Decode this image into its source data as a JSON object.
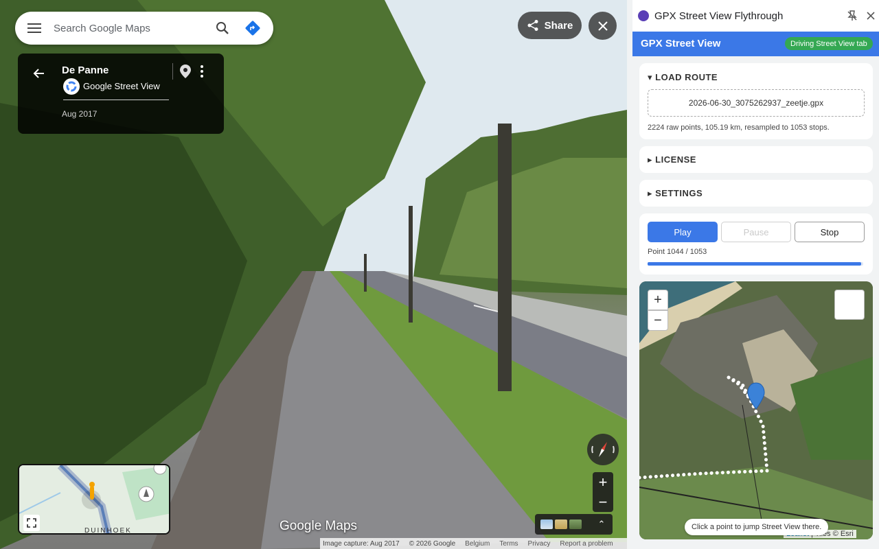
{
  "maps": {
    "search_placeholder": "Search Google Maps",
    "place": {
      "title": "De Panne",
      "provider": "Google Street View",
      "date": "Aug 2017"
    },
    "share_label": "Share",
    "logo_text": "Google Maps",
    "minimap_label": "DUINHOEK",
    "footer": {
      "capture": "Image capture: Aug 2017",
      "copyright": "© 2026 Google",
      "country": "Belgium",
      "terms": "Terms",
      "privacy": "Privacy",
      "report": "Report a problem"
    },
    "zoom_in": "+",
    "zoom_out": "−",
    "expand_glyph": "⌃"
  },
  "extension": {
    "window_title": "GPX Street View Flythrough",
    "app_title": "GPX Street View",
    "badge": "Driving Street View tab",
    "sections": {
      "load_route": "LOAD ROUTE",
      "license": "LICENSE",
      "settings": "SETTINGS"
    },
    "file_name": "2026-06-30_3075262937_zeetje.gpx",
    "route_stats": "2224 raw points, 105.19 km, resampled to 1053 stops.",
    "controls": {
      "play": "Play",
      "pause": "Pause",
      "stop": "Stop"
    },
    "progress_text": "Point 1044 / 1053",
    "progress_fraction": 0.9915,
    "map": {
      "zoom_in": "+",
      "zoom_out": "−",
      "hint": "Click a point to jump Street View there.",
      "attribution_leaflet": "Leaflet",
      "attribution_sep": " | ",
      "attribution_tiles": "Tiles © Esri"
    },
    "accent_color": "#3b78e7",
    "badge_color": "#34a853"
  }
}
